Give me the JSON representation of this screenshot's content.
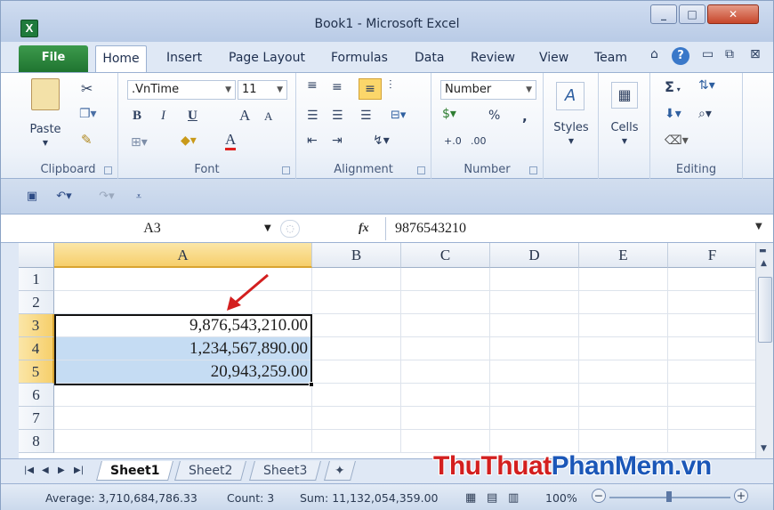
{
  "window": {
    "title": "Book1 - Microsoft Excel",
    "app_icon": "X"
  },
  "tabs": {
    "file": "File",
    "home": "Home",
    "insert": "Insert",
    "page_layout": "Page Layout",
    "formulas": "Formulas",
    "data": "Data",
    "review": "Review",
    "view": "View",
    "team": "Team"
  },
  "ribbon": {
    "clipboard": {
      "label": "Clipboard",
      "paste": "Paste"
    },
    "font": {
      "label": "Font",
      "name": ".VnTime",
      "size": "11",
      "bold": "B",
      "italic": "I",
      "underline": "U",
      "grow": "A",
      "shrink": "A",
      "color_letter": "A"
    },
    "alignment": {
      "label": "Alignment"
    },
    "number": {
      "label": "Number",
      "format": "Number",
      "percent": "%",
      "comma": ","
    },
    "styles": {
      "label": "Styles"
    },
    "cells": {
      "label": "Cells"
    },
    "editing": {
      "label": "Editing",
      "sum": "Σ"
    }
  },
  "formula_bar": {
    "name_box": "A3",
    "fx": "fx",
    "value": "9876543210"
  },
  "grid": {
    "columns": [
      "A",
      "B",
      "C",
      "D",
      "E",
      "F"
    ],
    "rows": [
      "1",
      "2",
      "3",
      "4",
      "5",
      "6",
      "7",
      "8"
    ],
    "cells": {
      "A3": "9,876,543,210.00",
      "A4": "1,234,567,890.00",
      "A5": "20,943,259.00"
    },
    "active_cell": "A3",
    "selection": "A3:A5"
  },
  "sheets": [
    "Sheet1",
    "Sheet2",
    "Sheet3"
  ],
  "status": {
    "average": "Average: 3,710,684,786.33",
    "count": "Count: 3",
    "sum": "Sum: 11,132,054,359.00",
    "zoom": "100%"
  },
  "watermark": {
    "part1": "ThuThuat",
    "part2": "PhanMem",
    "part3": ".vn"
  },
  "colors": {
    "file_tab": "#2a8a3d",
    "selection": "#c5dcf3",
    "active_header": "#f6cf6b",
    "arrow": "#d31f1f"
  }
}
